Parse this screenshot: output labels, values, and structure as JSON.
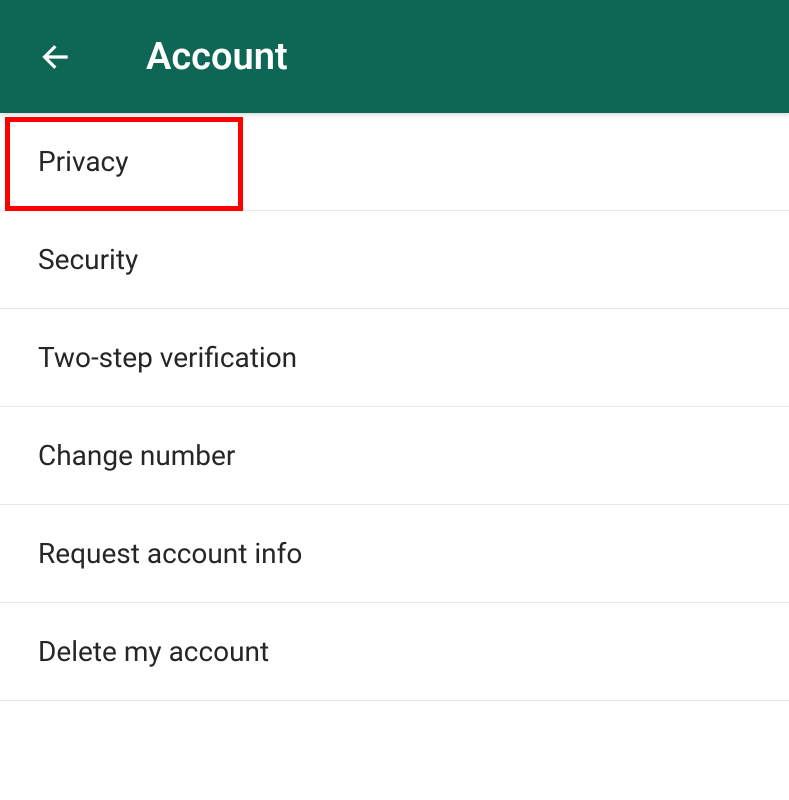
{
  "header": {
    "title": "Account"
  },
  "list": {
    "items": [
      {
        "label": "Privacy",
        "highlighted": true
      },
      {
        "label": "Security",
        "highlighted": false
      },
      {
        "label": "Two-step verification",
        "highlighted": false
      },
      {
        "label": "Change number",
        "highlighted": false
      },
      {
        "label": "Request account info",
        "highlighted": false
      },
      {
        "label": "Delete my account",
        "highlighted": false
      }
    ]
  },
  "colors": {
    "header_bg": "#0e6655",
    "highlight_border": "#ff0000"
  }
}
